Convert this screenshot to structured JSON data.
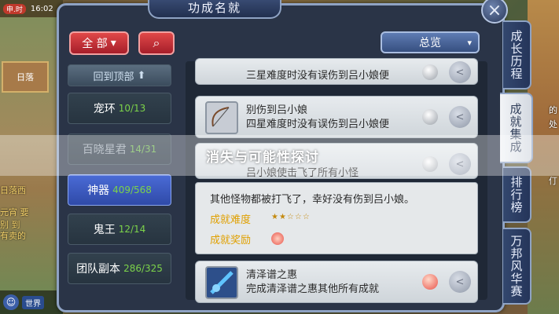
{
  "hud": {
    "time": "16:02",
    "badge": "申.时"
  },
  "background_left": {
    "map_label": "日落",
    "lines": [
      "日落西",
      "元宵 要",
      "别 到",
      "有卖的"
    ]
  },
  "background_right": {
    "lines": [
      "的",
      "处",
      "仃"
    ]
  },
  "world_chat": {
    "tag": "世界"
  },
  "dialog": {
    "title": "功成名就",
    "close_glyph": "×",
    "filter_label": "全 部",
    "filter_chevron": "▾",
    "search_glyph": "⌕",
    "overview_label": "总览",
    "overview_chevron": "▾"
  },
  "categories": [
    {
      "label": "回到顶部",
      "count": "",
      "glyph": "⬆"
    },
    {
      "label": "宠环",
      "count": "10/13"
    },
    {
      "label": "百晓星君",
      "count": "14/31"
    },
    {
      "label": "神器",
      "count": "409/568"
    },
    {
      "label": "鬼王",
      "count": "12/14"
    },
    {
      "label": "团队副本",
      "count": "286/325"
    }
  ],
  "achievements": [
    {
      "name": "",
      "desc": "三星难度时没有误伤到吕小娘便"
    },
    {
      "name": "别伤到吕小娘",
      "desc": "四星难度时没有误伤到吕小娘便"
    },
    {
      "name": "吕小娘使击飞了所有小怪",
      "desc": ""
    },
    {
      "name": "清泽谱之惠",
      "desc": "完成清泽谱之惠其他所有成就"
    }
  ],
  "detail": {
    "text": "其他怪物都被打飞了，幸好没有伤到吕小娘。",
    "difficulty_label": "成就难度",
    "difficulty_stars": "★★☆☆☆",
    "reward_label": "成就奖励"
  },
  "side_tabs": [
    {
      "label": "成长历程"
    },
    {
      "label": "成就集成"
    },
    {
      "label": "排行榜"
    },
    {
      "label": "万邦风华赛"
    }
  ],
  "overlay": {
    "caption": "消失与可能性探讨"
  },
  "colors": {
    "accent_red": "#c0282f",
    "accent_blue": "#3b58c0",
    "count_green": "#7cd34a"
  }
}
